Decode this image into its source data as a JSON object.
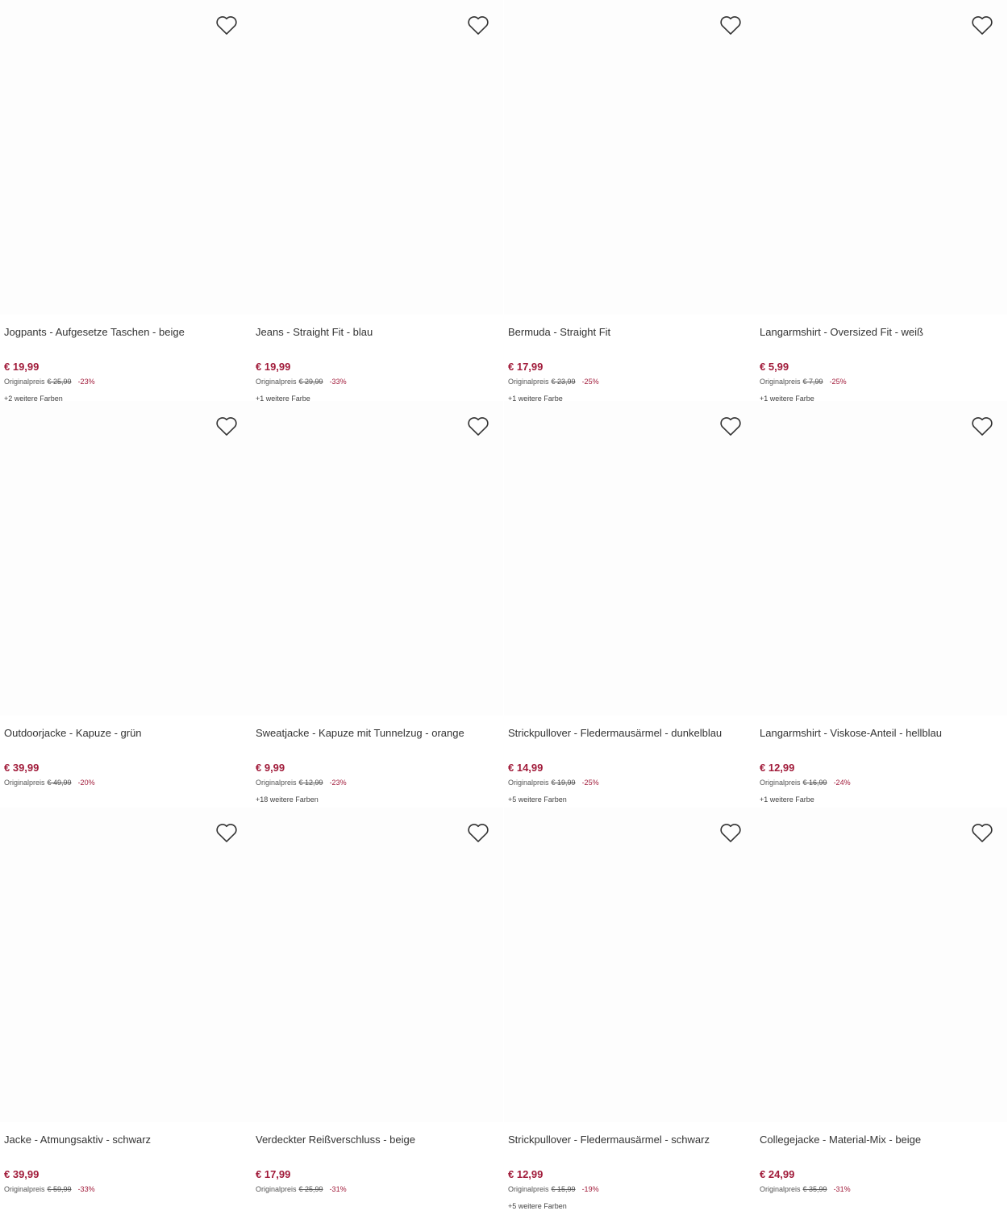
{
  "icons": {
    "wishlist": "heart-outline-icon"
  },
  "colors": {
    "price": "#a11b3a",
    "discount": "#a11b3a",
    "text": "#333333"
  },
  "products": [
    {
      "title": "Jogpants - Aufgesetze Taschen - beige",
      "price": "€ 19,99",
      "orig_label": "Originalpreis",
      "orig_price": "€ 25,99",
      "discount": "-23%",
      "colors": "+2 weitere Farben"
    },
    {
      "title": "Jeans - Straight Fit - blau",
      "price": "€ 19,99",
      "orig_label": "Originalpreis",
      "orig_price": "€ 29,99",
      "discount": "-33%",
      "colors": "+1 weitere Farbe"
    },
    {
      "title": "Bermuda - Straight Fit",
      "price": "€ 17,99",
      "orig_label": "Originalpreis",
      "orig_price": "€ 23,99",
      "discount": "-25%",
      "colors": "+1 weitere Farbe"
    },
    {
      "title": "Langarmshirt - Oversized Fit - weiß",
      "price": "€ 5,99",
      "orig_label": "Originalpreis",
      "orig_price": "€ 7,99",
      "discount": "-25%",
      "colors": "+1 weitere Farbe"
    },
    {
      "title": "Outdoorjacke - Kapuze - grün",
      "price": "€ 39,99",
      "orig_label": "Originalpreis",
      "orig_price": "€ 49,99",
      "discount": "-20%",
      "colors": ""
    },
    {
      "title": "Sweatjacke - Kapuze mit Tunnelzug - orange",
      "price": "€ 9,99",
      "orig_label": "Originalpreis",
      "orig_price": "€ 12,99",
      "discount": "-23%",
      "colors": "+18 weitere Farben"
    },
    {
      "title": "Strickpullover - Fledermausärmel - dunkelblau",
      "price": "€ 14,99",
      "orig_label": "Originalpreis",
      "orig_price": "€ 19,99",
      "discount": "-25%",
      "colors": "+5 weitere Farben"
    },
    {
      "title": "Langarmshirt - Viskose-Anteil - hellblau",
      "price": "€ 12,99",
      "orig_label": "Originalpreis",
      "orig_price": "€ 16,99",
      "discount": "-24%",
      "colors": "+1 weitere Farbe"
    },
    {
      "title": "Jacke - Atmungsaktiv - schwarz",
      "price": "€ 39,99",
      "orig_label": "Originalpreis",
      "orig_price": "€ 59,99",
      "discount": "-33%",
      "colors": ""
    },
    {
      "title": "Verdeckter Reißverschluss - beige",
      "price": "€ 17,99",
      "orig_label": "Originalpreis",
      "orig_price": "€ 25,99",
      "discount": "-31%",
      "colors": ""
    },
    {
      "title": "Strickpullover - Fledermausärmel - schwarz",
      "price": "€ 12,99",
      "orig_label": "Originalpreis",
      "orig_price": "€ 15,99",
      "discount": "-19%",
      "colors": "+5 weitere Farben"
    },
    {
      "title": "Collegejacke - Material-Mix - beige",
      "price": "€ 24,99",
      "orig_label": "Originalpreis",
      "orig_price": "€ 35,99",
      "discount": "-31%",
      "colors": ""
    }
  ]
}
